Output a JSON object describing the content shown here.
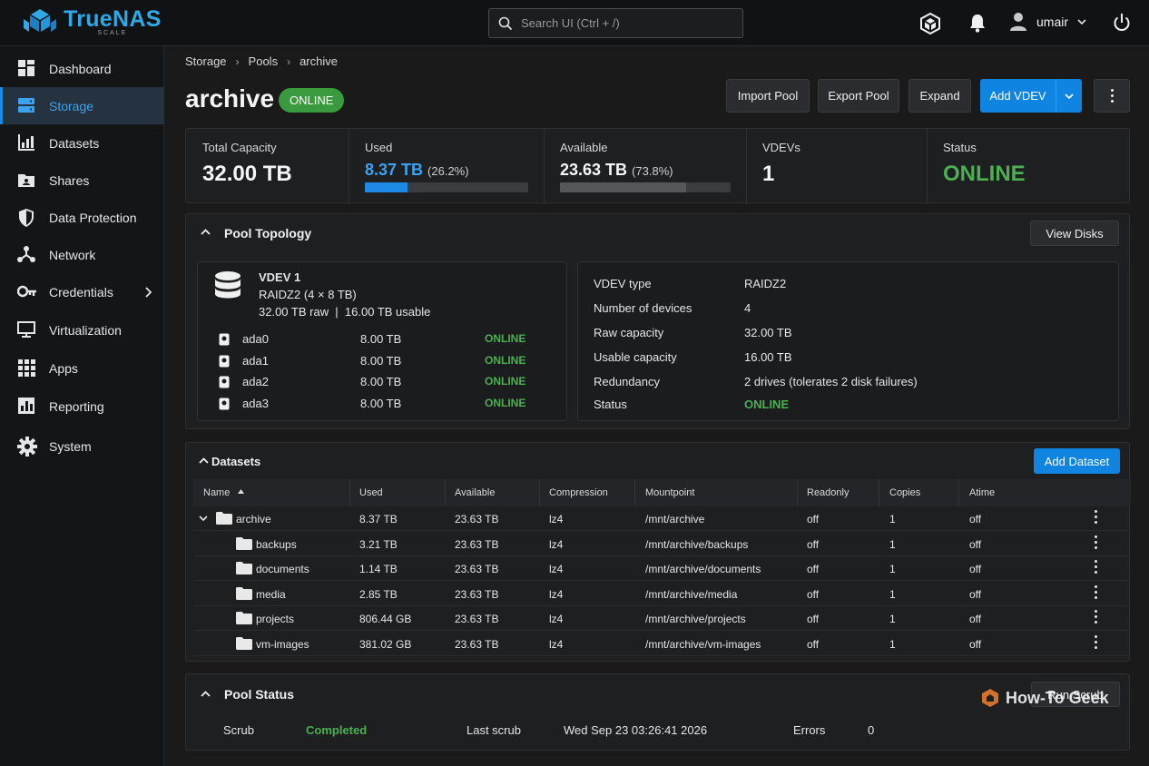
{
  "app": {
    "logo_text": "TrueNAS",
    "logo_sub": "SCALE",
    "search_placeholder": "Search UI (Ctrl + /)",
    "username": "umair"
  },
  "sidebar": {
    "items": [
      {
        "label": "Dashboard",
        "icon": "dashboard-icon"
      },
      {
        "label": "Storage",
        "icon": "storage-icon",
        "active": true
      },
      {
        "label": "Datasets",
        "icon": "datasets-icon"
      },
      {
        "label": "Shares",
        "icon": "shares-icon"
      },
      {
        "label": "Data Protection",
        "icon": "shield-icon"
      },
      {
        "label": "Network",
        "icon": "network-icon"
      },
      {
        "label": "Credentials",
        "icon": "key-icon"
      },
      {
        "label": "Virtualization",
        "icon": "monitor-icon"
      },
      {
        "label": "Apps",
        "icon": "apps-grid-icon"
      },
      {
        "label": "Reporting",
        "icon": "reporting-icon"
      },
      {
        "label": "System",
        "icon": "gear-icon"
      }
    ]
  },
  "breadcrumb": [
    "Storage",
    "Pools",
    "archive"
  ],
  "pool": {
    "name": "archive",
    "status_badge": "ONLINE"
  },
  "actions": {
    "import_pool": "Import Pool",
    "export_pool": "Export Pool",
    "expand": "Expand",
    "add_vdev": "Add VDEV"
  },
  "stats": {
    "total_capacity_label": "Total Capacity",
    "total_capacity": "32.00 TB",
    "used_label": "Used",
    "used_value": "8.37 TB",
    "used_pct": "(26.2%)",
    "used_fraction": 0.262,
    "available_label": "Available",
    "available_value": "23.63 TB",
    "available_pct": "(73.8%)",
    "available_fraction": 0.738,
    "vdevs_label": "VDEVs",
    "vdevs_value": "1",
    "status_label": "Status",
    "status_value": "ONLINE"
  },
  "topology": {
    "title": "Pool Topology",
    "view_disks": "View Disks",
    "vdev_name": "VDEV 1",
    "vdev_layout": "RAIDZ2 (4 × 8 TB)",
    "vdev_capacity": "32.00 TB raw  |  16.00 TB usable",
    "disks": [
      {
        "name": "ada0",
        "size": "8.00 TB",
        "status": "ONLINE"
      },
      {
        "name": "ada1",
        "size": "8.00 TB",
        "status": "ONLINE"
      },
      {
        "name": "ada2",
        "size": "8.00 TB",
        "status": "ONLINE"
      },
      {
        "name": "ada3",
        "size": "8.00 TB",
        "status": "ONLINE"
      }
    ],
    "details": [
      {
        "label": "VDEV type",
        "value": "RAIDZ2"
      },
      {
        "label": "Number of devices",
        "value": "4"
      },
      {
        "label": "Raw capacity",
        "value": "32.00 TB"
      },
      {
        "label": "Usable capacity",
        "value": "16.00 TB"
      },
      {
        "label": "Redundancy",
        "value": "2 drives (tolerates 2 disk failures)"
      },
      {
        "label": "Status",
        "value": "ONLINE"
      }
    ]
  },
  "datasets": {
    "title": "Datasets",
    "add_button": "Add Dataset",
    "columns": [
      "Name",
      "Used",
      "Available",
      "Compression",
      "Mountpoint",
      "Readonly",
      "Copies",
      "Atime"
    ],
    "rows": [
      {
        "name": "archive",
        "used": "8.37 TB",
        "available": "23.63 TB",
        "compression": "lz4",
        "mountpoint": "/mnt/archive",
        "readonly": "off",
        "copies": "1",
        "atime": "off"
      },
      {
        "name": "backups",
        "used": "3.21 TB",
        "available": "23.63 TB",
        "compression": "lz4",
        "mountpoint": "/mnt/archive/backups",
        "readonly": "off",
        "copies": "1",
        "atime": "off"
      },
      {
        "name": "documents",
        "used": "1.14 TB",
        "available": "23.63 TB",
        "compression": "lz4",
        "mountpoint": "/mnt/archive/documents",
        "readonly": "off",
        "copies": "1",
        "atime": "off"
      },
      {
        "name": "media",
        "used": "2.85 TB",
        "available": "23.63 TB",
        "compression": "lz4",
        "mountpoint": "/mnt/archive/media",
        "readonly": "off",
        "copies": "1",
        "atime": "off"
      },
      {
        "name": "projects",
        "used": "806.44 GB",
        "available": "23.63 TB",
        "compression": "lz4",
        "mountpoint": "/mnt/archive/projects",
        "readonly": "off",
        "copies": "1",
        "atime": "off"
      },
      {
        "name": "vm-images",
        "used": "381.02 GB",
        "available": "23.63 TB",
        "compression": "lz4",
        "mountpoint": "/mnt/archive/vm-images",
        "readonly": "off",
        "copies": "1",
        "atime": "off"
      }
    ]
  },
  "pool_status": {
    "title": "Pool Status",
    "run_scrub": "Run Scrub",
    "scrub_label": "Scrub",
    "scrub_value": "Completed",
    "last_scrub_label": "Last scrub",
    "last_scrub_value": "Wed Sep 23 03:26:41 2026",
    "errors_label": "Errors",
    "errors_value": "0"
  },
  "watermark": "How-To Geek",
  "colors": {
    "accent": "#0f84e0",
    "online_green": "#4caf50",
    "used_bar": "#1e88e5",
    "available_bar": "#55575b"
  }
}
